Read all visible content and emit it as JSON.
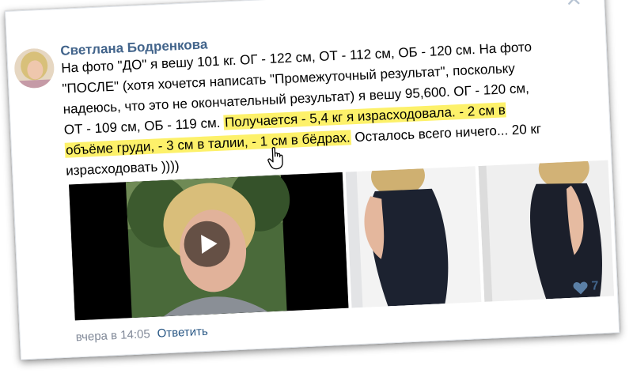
{
  "comment": {
    "author": "Светлана Бодренкова",
    "text_lines": [
      "На фото \"ДО\" я вешу 101 кг. ОГ - 122 см, ОТ - 112 см, ОБ - 120 см. На фото",
      "\"ПОСЛЕ\" (хотя хочется написать \"Промежуточный результат\", поскольку",
      "надеюсь, что это не окончательный результат) я вешу 95,600. ОГ - 120 см,"
    ],
    "line4_plain": "ОТ - 109 см, ОБ - 119 см. ",
    "line4_highlight": "Получается - 5,4 кг я израсходовала. - 2 см в",
    "line5_highlight": "объёме груди, - 3 см в талии, - 1 см в бёдрах.",
    "line5_plain": " Осталось всего ничего... 20 кг",
    "line6": "израсходовать ))))",
    "timestamp": "вчера в 14:05",
    "reply_label": "Ответить",
    "likes": "7"
  },
  "icons": {
    "close": "close-icon",
    "play": "play-icon",
    "like": "heart-icon",
    "cursor": "hand-cursor-icon"
  },
  "colors": {
    "author": "#42648b",
    "link": "#2a5885",
    "highlight": "#fdf16a",
    "muted": "#828a99"
  }
}
